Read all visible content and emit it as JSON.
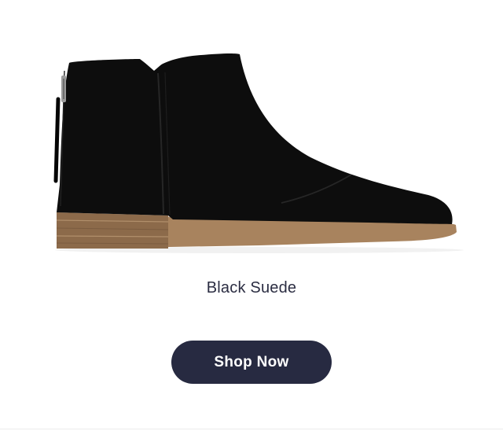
{
  "product": {
    "name": "Black Suede",
    "image_icon": "ankle-boot-icon",
    "colors": {
      "suede": "#0d0d0d",
      "sole": "#a8835e",
      "stacked_heel": "#8c6a4a",
      "zipper": "#9a9a9a"
    }
  },
  "cta": {
    "label": "Shop Now",
    "background": "#272a41",
    "text_color": "#ffffff"
  }
}
